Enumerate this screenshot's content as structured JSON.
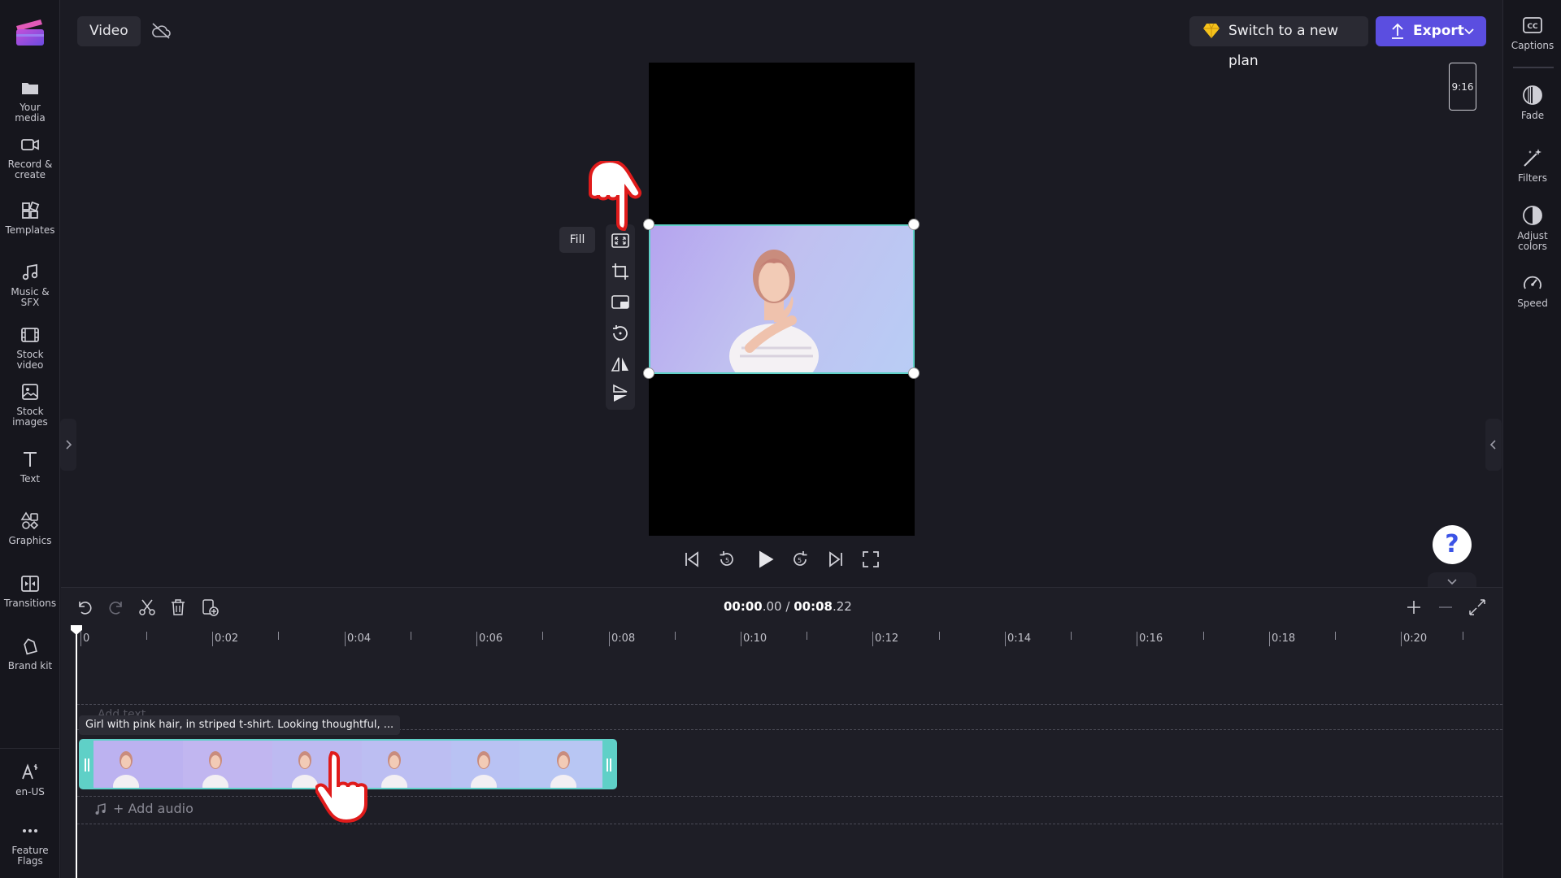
{
  "app": {
    "tab_label": "Video"
  },
  "left_nav": {
    "items": [
      {
        "label": "Your media",
        "icon": "folder-icon"
      },
      {
        "label": "Record & create",
        "icon": "camera-icon"
      },
      {
        "label": "Templates",
        "icon": "templates-icon"
      },
      {
        "label": "Music & SFX",
        "icon": "music-icon"
      },
      {
        "label": "Stock video",
        "icon": "film-icon"
      },
      {
        "label": "Stock images",
        "icon": "image-icon"
      },
      {
        "label": "Text",
        "icon": "text-icon"
      },
      {
        "label": "Graphics",
        "icon": "shapes-icon"
      },
      {
        "label": "Transitions",
        "icon": "transitions-icon"
      },
      {
        "label": "Brand kit",
        "icon": "brand-kit-icon"
      }
    ],
    "bottom_items": [
      {
        "label": "en-US",
        "icon": "language-icon"
      },
      {
        "label": "Feature Flags",
        "icon": "more-icon"
      }
    ]
  },
  "header": {
    "plan_button": "Switch to a new plan",
    "export_button": "Export"
  },
  "right_panel": {
    "items": [
      {
        "label": "Captions",
        "icon": "captions-icon"
      },
      {
        "label": "Fade",
        "icon": "fade-icon"
      },
      {
        "label": "Filters",
        "icon": "filters-icon"
      },
      {
        "label": "Adjust colors",
        "icon": "adjust-colors-icon"
      },
      {
        "label": "Speed",
        "icon": "speed-icon"
      }
    ]
  },
  "preview": {
    "aspect_ratio": "9:16",
    "fill_tooltip": "Fill"
  },
  "timeline": {
    "current_time_main": "00:00",
    "current_time_frac": ".00",
    "separator": "/",
    "total_time_main": "00:08",
    "total_time_frac": ".22",
    "ruler_labels": [
      "0",
      "0:02",
      "0:04",
      "0:06",
      "0:08",
      "0:10",
      "0:12",
      "0:14",
      "0:16",
      "0:18",
      "0:20"
    ],
    "add_text_ghost": "Add text",
    "clip_caption": "Girl with pink hair, in striped t-shirt. Looking thoughtful, ...",
    "add_audio": "+ Add audio"
  },
  "colors": {
    "accent": "#5b4ee0",
    "clip_border": "#5fd0c7",
    "background": "#1b1b23",
    "cursor_red": "#e01b1b"
  }
}
